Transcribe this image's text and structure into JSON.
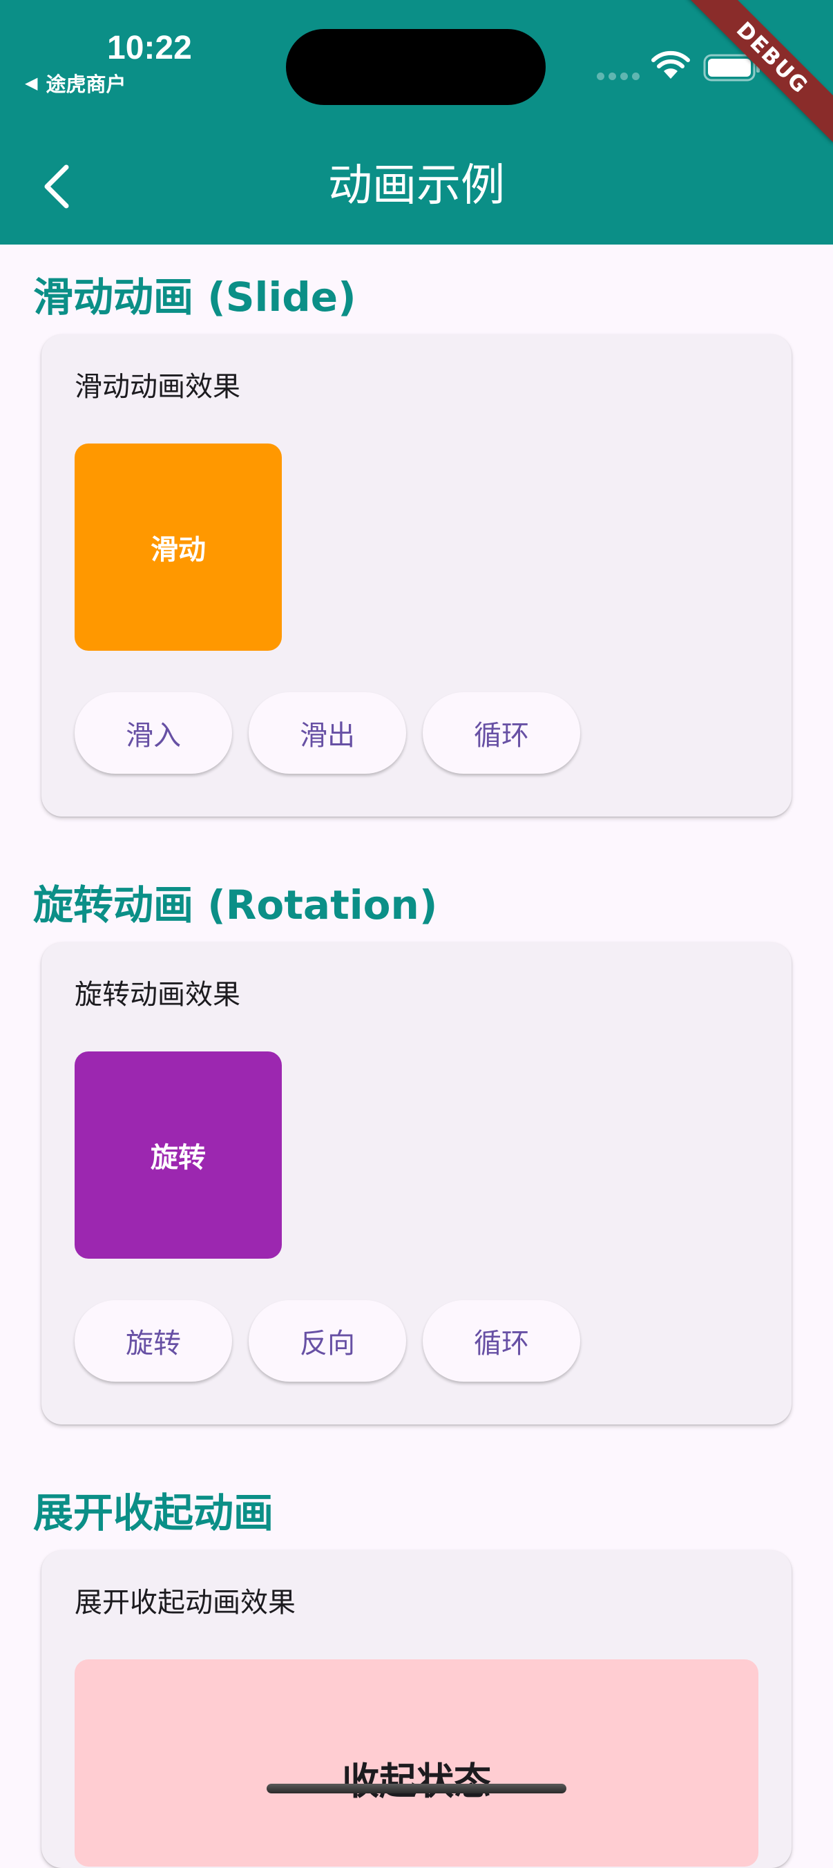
{
  "status_bar": {
    "time": "10:22",
    "back_app": "途虎商户",
    "back_arrow_glyph": "◀"
  },
  "debug_banner": "DEBUG",
  "app_bar": {
    "title": "动画示例",
    "back_icon": "chevron-left-icon"
  },
  "sections": {
    "slide": {
      "title": "滑动动画 (Slide)",
      "subtitle": "滑动动画效果",
      "box_label": "滑动",
      "box_color": "#FF9800",
      "buttons": [
        "滑入",
        "滑出",
        "循环"
      ]
    },
    "rotation": {
      "title": "旋转动画 (Rotation)",
      "subtitle": "旋转动画效果",
      "box_label": "旋转",
      "box_color": "#9C27B0",
      "buttons": [
        "旋转",
        "反向",
        "循环"
      ]
    },
    "expand": {
      "title": "展开收起动画",
      "subtitle": "展开收起动画效果",
      "state_label": "收起状态",
      "panel_color": "#FFCDD2"
    }
  },
  "colors": {
    "primary": "#0B8F87",
    "button_text": "#6750A4",
    "background": "#FDF7FE",
    "card": "#F4EFF6"
  }
}
